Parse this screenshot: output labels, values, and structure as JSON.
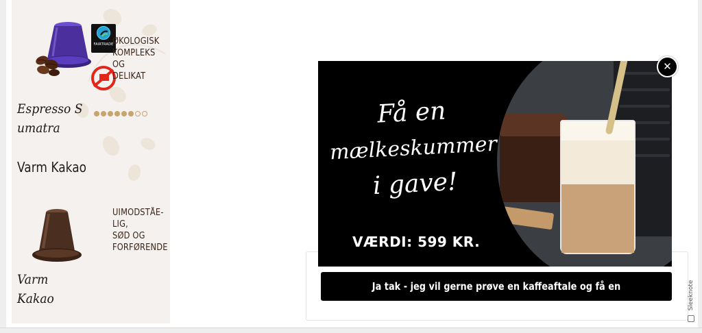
{
  "sidebar": {
    "product1": {
      "fairtrade_label": "FAIRTRADE",
      "description_lines": [
        "ØKOLOGISK",
        "KOMPLEKS OG",
        "DELIKAT"
      ],
      "name_lines": [
        "Espresso S",
        "umatra"
      ],
      "intensity": {
        "filled": 6,
        "total": 8
      }
    },
    "heading": "Varm Kakao",
    "product2": {
      "description_lines": [
        "UIMODSTÅE-",
        "LIG,",
        "SØD OG",
        "FORFØRENDE"
      ],
      "name_lines": [
        "Varm",
        "Kakao"
      ]
    }
  },
  "popup": {
    "headline_lines": [
      "Få en",
      "mælkeskummer",
      "i gave!"
    ],
    "value_text": "VÆRDI: 599 KR.",
    "cta_label": "Ja tak - jeg vil gerne prøve en kaffeaftale og få en mælkeskummer!",
    "close_icon": "close-icon",
    "branding": "Sleeknote"
  },
  "colors": {
    "accent_gold": "#c8a46e",
    "text_brown": "#3b2518",
    "promo_bg": "#000000",
    "capsule_purple": "#4b2f9c",
    "capsule_brown": "#4a2e1f"
  }
}
